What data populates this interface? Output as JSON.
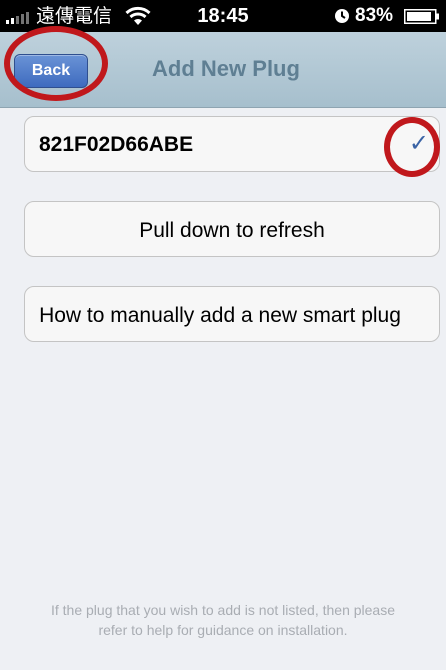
{
  "status_bar": {
    "carrier": "遠傳電信",
    "time": "18:45",
    "battery": "83%",
    "icons": [
      "signal-icon",
      "wifi-icon",
      "alarm-icon",
      "battery-icon"
    ]
  },
  "nav": {
    "title": "Add New Plug",
    "back_label": "Back"
  },
  "plugs": [
    {
      "id": "821F02D66ABE",
      "selected": true
    }
  ],
  "actions": {
    "refresh_label": "Pull down to refresh",
    "manual_label": "How to manually add a new smart plug"
  },
  "footer": {
    "help_line1": "If the plug that you wish to add is not listed, then please",
    "help_line2": "refer to help for guidance on installation."
  },
  "colors": {
    "nav_background": "#b3c8d4",
    "nav_title": "#5f7f93",
    "back_button": "#4a78c9",
    "checkmark": "#3a63a5",
    "annotation": "#c0181c",
    "page_background": "#eef0f4"
  }
}
